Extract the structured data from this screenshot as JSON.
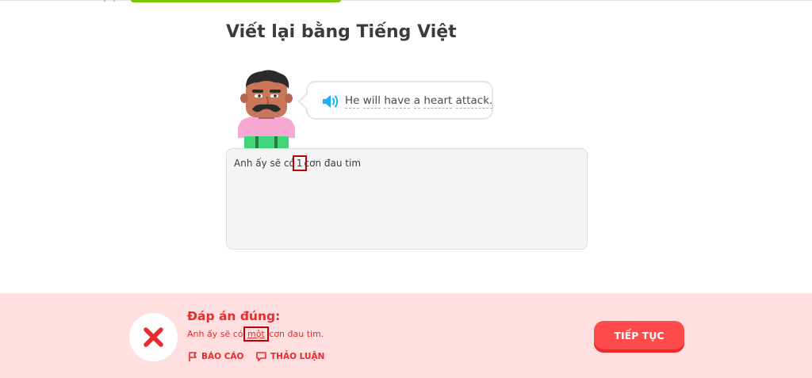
{
  "exercise": {
    "title": "Viết lại bằng Tiếng Việt",
    "prompt_tokens": [
      "He",
      "will",
      "have",
      "a",
      "heart",
      "attack."
    ]
  },
  "answer": {
    "before": "Anh ấy sẽ có",
    "highlight": "1",
    "after": "cơn đau tim"
  },
  "feedback": {
    "title": "Đáp án đúng:",
    "answer_before": "Anh ấy sẽ có",
    "answer_highlight": "một",
    "answer_after": "cơn đau tim.",
    "report_label": "BÁO CÁO",
    "discuss_label": "THẢO LUẬN",
    "continue_label": "TIẾP TỤC"
  },
  "colors": {
    "error": "#ea2b2b",
    "footer_bg": "#ffdfe0",
    "progress": "#78c800",
    "speaker": "#1cb0f6",
    "highlight_box": "#c00000"
  },
  "icons": [
    "speaker-icon",
    "x-mark-icon",
    "flag-icon",
    "comment-icon"
  ]
}
